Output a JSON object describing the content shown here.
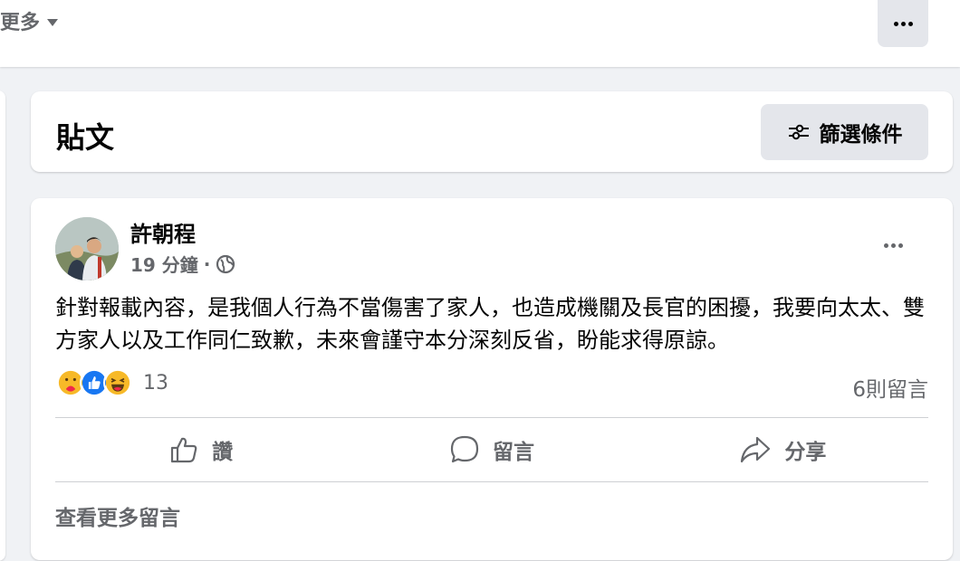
{
  "topbar": {
    "more_label": "更多",
    "more_icon": "caret-down-icon",
    "options_icon": "more-dots-icon"
  },
  "posts_header": {
    "title": "貼文",
    "filter_label": "篩選條件",
    "filter_icon": "filter-sliders-icon"
  },
  "post": {
    "author": "許朝程",
    "time": "19 分鐘",
    "separator": "·",
    "privacy_icon": "globe-icon",
    "text": "針對報載內容，是我個人行為不當傷害了家人，也造成機關及長官的困擾，我要向太太、雙方家人以及工作同仁致歉，未來會謹守本分深刻反省，盼能求得原諒。",
    "reaction_icons": [
      "care-reaction-icon",
      "like-reaction-icon",
      "haha-reaction-icon"
    ],
    "reaction_count": "13",
    "comment_count": "6則留言",
    "actions": {
      "like": "讚",
      "comment": "留言",
      "share": "分享"
    },
    "view_more_comments": "查看更多留言"
  },
  "colors": {
    "background": "#f0f2f5",
    "card": "#ffffff",
    "secondary_text": "#65676b",
    "button_gray": "#e4e6eb",
    "like_blue": "#1877f2",
    "reaction_yellow": "#f7b928"
  }
}
